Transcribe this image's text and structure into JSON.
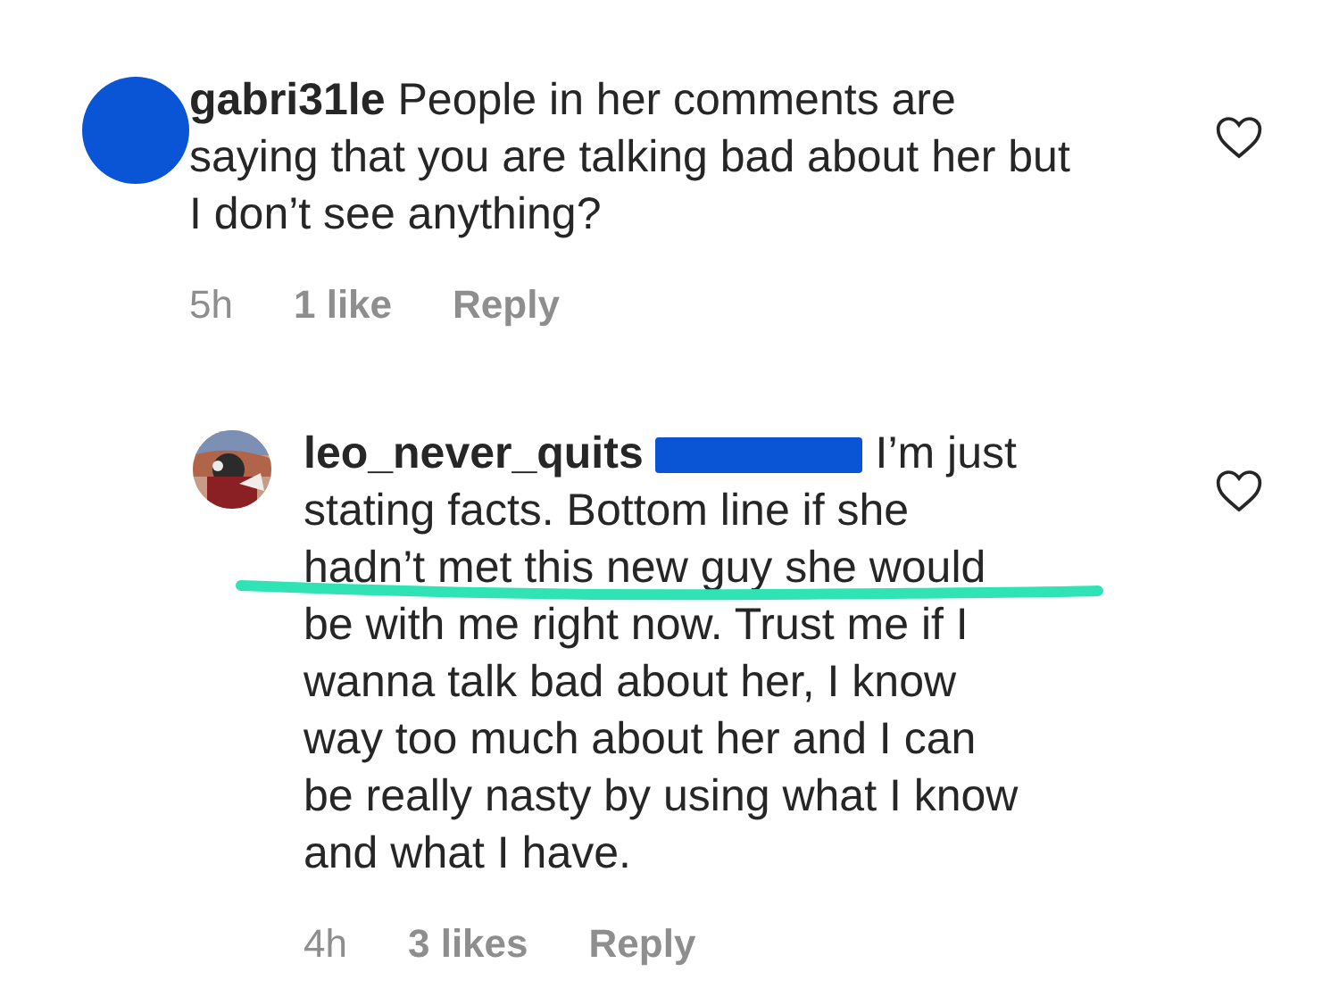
{
  "comments": [
    {
      "avatar": {
        "kind": "redacted"
      },
      "username": "gabri31le",
      "mention_redacted": false,
      "text": "People in her comments are saying that you are talking bad about her but I don’t see anything?",
      "time": "5h",
      "likes": "1 like",
      "reply": "Reply",
      "liked": false,
      "underline": false
    },
    {
      "username": "leo_never_quits",
      "mention_redacted": true,
      "text": "I’m just stating facts. Bottom line if she hadn’t met this new guy she would be with me right now. Trust me if I wanna talk bad about her, I know way too much about her and I can be really nasty by using what I know and what I have.",
      "time": "4h",
      "likes": "3 likes",
      "reply": "Reply",
      "liked": false,
      "underline": true
    }
  ]
}
